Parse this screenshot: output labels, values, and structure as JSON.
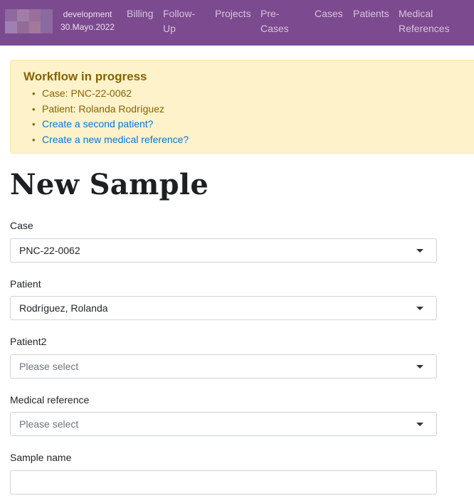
{
  "nav": {
    "environment": "development",
    "date": "30.Mayo.2022",
    "items": [
      {
        "label": "Billing"
      },
      {
        "label": "Follow-Up"
      },
      {
        "label": "Projects"
      },
      {
        "label": "Pre-Cases"
      },
      {
        "label": "Cases"
      },
      {
        "label": "Patients"
      },
      {
        "label": "Medical References"
      }
    ]
  },
  "workflow": {
    "title": "Workflow in progress",
    "items": [
      {
        "text": "Case: PNC-22-0062"
      },
      {
        "text": "Patient: Rolanda Rodríguez"
      },
      {
        "text": "Create a second patient?"
      },
      {
        "text": "Create a new medical reference?"
      }
    ]
  },
  "page": {
    "title": "New Sample"
  },
  "form": {
    "case": {
      "label": "Case",
      "value": "PNC-22-0062"
    },
    "patient": {
      "label": "Patient",
      "value": "Rodríguez, Rolanda"
    },
    "patient2": {
      "label": "Patient2",
      "placeholder": "Please select"
    },
    "medical_reference": {
      "label": "Medical reference",
      "placeholder": "Please select"
    },
    "sample_name": {
      "label": "Sample name",
      "value": ""
    }
  },
  "colors": {
    "navbar": "#7c4a8e",
    "alert_bg": "#fdf2c9",
    "alert_text": "#856404",
    "link": "#0b74d6"
  }
}
